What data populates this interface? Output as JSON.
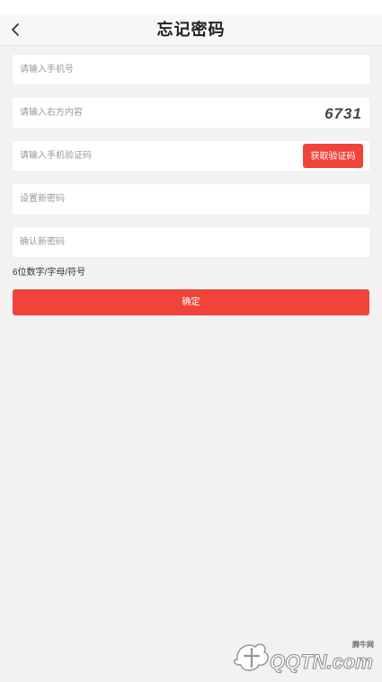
{
  "header": {
    "title": "忘记密码",
    "back_icon": "chevron-left-icon"
  },
  "form": {
    "phone_placeholder": "请输入手机号",
    "captcha_placeholder": "请输入右方内容",
    "captcha_code": "6731",
    "sms_code_placeholder": "请输入手机验证码",
    "sms_button_label": "获取验证码",
    "new_password_placeholder": "设置新密码",
    "confirm_password_placeholder": "确认新密码",
    "password_hint": "6位数字/字母/符号",
    "submit_label": "确定"
  },
  "watermark": {
    "site_name": "腾牛网",
    "brand_text": "QQTN.com"
  },
  "colors": {
    "accent": "#f0443a",
    "background": "#f2f2f2",
    "field_background": "#ffffff"
  }
}
